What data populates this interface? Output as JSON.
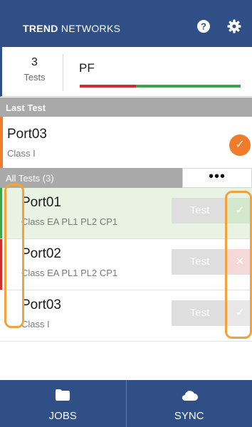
{
  "header": {
    "brand_bold": "TREND",
    "brand_rest": " NETWORKS",
    "help_icon": "help-icon",
    "settings_icon": "gear-icon",
    "color": "#2f4f86"
  },
  "summary": {
    "count": "3",
    "count_label": "Tests",
    "status": "PF",
    "fail_fraction": 0.35
  },
  "last_test": {
    "section_label": "Last Test",
    "title": "Port03",
    "subtitle": "Class I",
    "status_icon": "check-circle-icon",
    "accent": "#f07b2a"
  },
  "all_tests": {
    "section_label": "All Tests (3)",
    "more_label": "•••",
    "rows": [
      {
        "title": "Port01",
        "subtitle": "Class EA PL1 PL2 CP1",
        "button": "Test",
        "mark": "✓",
        "status_color": "#3fa34d"
      },
      {
        "title": "Port02",
        "subtitle": "Class EA PL1 PL2 CP1",
        "button": "Test",
        "mark": "✕",
        "status_color": "#cc2e2e"
      },
      {
        "title": "Port03",
        "subtitle": "Class I",
        "button": "Test",
        "mark": "✓",
        "status_color": "#ffffff"
      }
    ]
  },
  "footer": {
    "jobs_label": "JOBS",
    "sync_label": "SYNC",
    "jobs_icon": "folder-icon",
    "sync_icon": "cloud-icon"
  },
  "highlight_color": "#f3a23b"
}
